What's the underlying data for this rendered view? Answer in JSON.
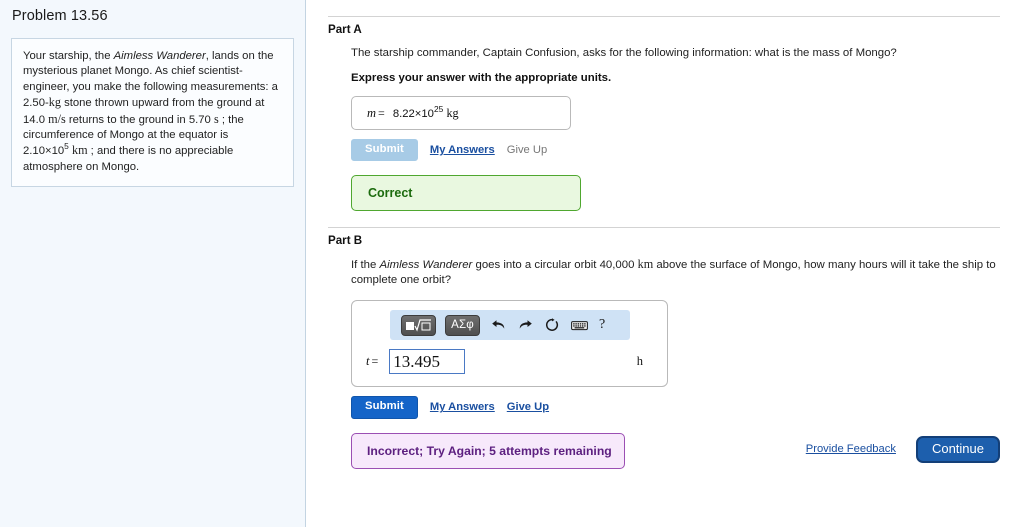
{
  "problem": {
    "title": "Problem 13.56",
    "statement_pre": "Your starship, the ",
    "ship_name": "Aimless Wanderer",
    "statement_1": ", lands on the mysterious planet Mongo. As chief scientist-engineer, you make the following measurements: a 2.50-",
    "unit_kg": "kg",
    "statement_2": " stone thrown upward from the ground at 14.0 ",
    "unit_ms": "m/s",
    "statement_3": " returns to the ground in 5.70 ",
    "unit_s": "s",
    "statement_4": " ; the circumference of Mongo at the equator is 2.10×10",
    "exp_5": "5",
    "unit_km": "km",
    "statement_5": " ; and there is no appreciable atmosphere on Mongo."
  },
  "part_a": {
    "label": "Part A",
    "question": "The starship commander, Captain Confusion, asks for the following information: what is the mass of Mongo?",
    "instruction": "Express your answer with the appropriate units.",
    "var": "m",
    "equals": "=",
    "value_mantissa": "8.22×10",
    "value_exponent": "25",
    "value_unit": "kg",
    "submit_label": "Submit",
    "my_answers_label": "My Answers",
    "give_up_label": "Give Up",
    "feedback": "Correct"
  },
  "part_b": {
    "label": "Part B",
    "question_pre": "If the ",
    "ship_name": "Aimless Wanderer",
    "question_post": " goes into a circular orbit 40,000 ",
    "unit_km": "km",
    "question_end": " above the surface of Mongo, how many hours will it take the ship to complete one orbit?",
    "toolbar": {
      "template_label": "▣√▯",
      "greek_label": "ΑΣφ",
      "undo_title": "undo",
      "redo_title": "redo",
      "reset_title": "reset",
      "keyboard_title": "keyboard",
      "help_label": "?"
    },
    "var": "t",
    "equals": "=",
    "input_value": "13.495",
    "input_placeholder": "",
    "unit": "h",
    "submit_label": "Submit",
    "my_answers_label": "My Answers",
    "give_up_label": "Give Up",
    "feedback": "Incorrect; Try Again; 5 attempts remaining"
  },
  "footer": {
    "provide_feedback_label": "Provide Feedback",
    "continue_label": "Continue"
  },
  "colors": {
    "accent_blue": "#1464c8",
    "correct_green": "#1c6b0e",
    "incorrect_purple": "#5d2080",
    "link_blue": "#1a4fa0",
    "toolbar_blue": "#cfe2f5",
    "panel_bg": "#f3f8fd"
  }
}
